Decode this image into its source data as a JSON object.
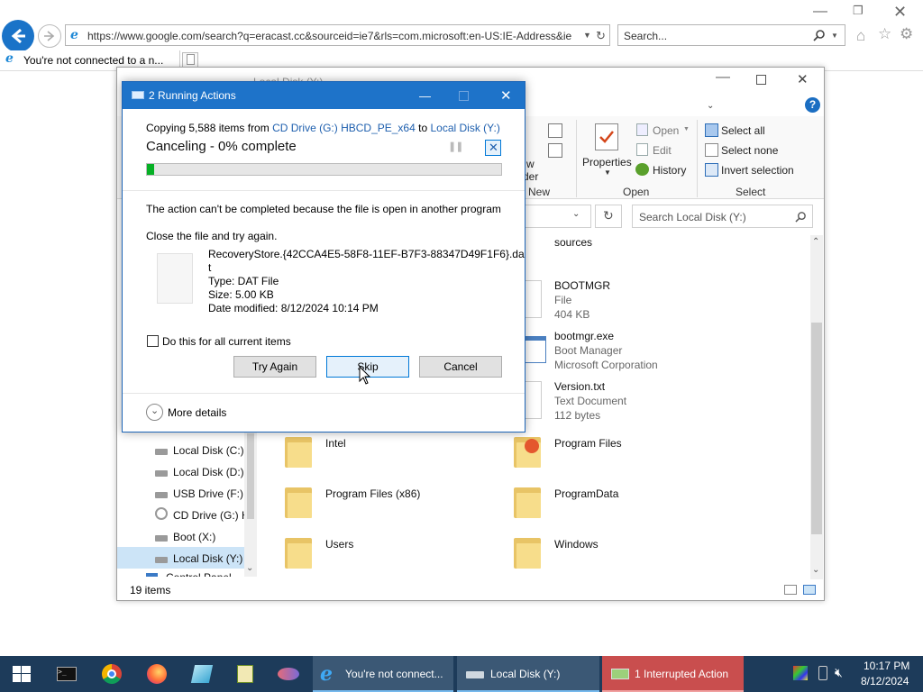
{
  "browser": {
    "address": "https://www.google.com/search?q=eracast.cc&sourceid=ie7&rls=com.microsoft:en-US:IE-Address&ie",
    "search_placeholder": "Search...",
    "tab_title": "You're not connected to a n..."
  },
  "explorer": {
    "title": "Local Disk (Y:)",
    "ribbon": {
      "new_partial": "w",
      "new_partial2": "der",
      "new_label": "New",
      "properties": "Properties",
      "open": "Open",
      "edit": "Edit",
      "history": "History",
      "open_group": "Open",
      "select_all": "Select all",
      "select_none": "Select none",
      "invert_selection": "Invert selection",
      "select_group": "Select"
    },
    "search_placeholder": "Search Local Disk (Y:)",
    "nav_items": [
      "Local Disk (C:)",
      "Local Disk (D:)",
      "USB Drive (F:)",
      "CD Drive (G:) H",
      "Boot (X:)",
      "Local Disk (Y:)",
      "Control Panel"
    ],
    "files": {
      "sources": "sources",
      "bootmgr": {
        "name": "BOOTMGR",
        "type": "File",
        "size": "404 KB"
      },
      "bootmgr_exe": {
        "name": "bootmgr.exe",
        "desc": "Boot Manager",
        "company": "Microsoft Corporation"
      },
      "version": {
        "name": "Version.txt",
        "type": "Text Document",
        "size": "112 bytes"
      },
      "intel": "Intel",
      "program_files": "Program Files",
      "program_files_x86": "Program Files (x86)",
      "program_data": "ProgramData",
      "users": "Users",
      "windows": "Windows"
    },
    "status": "19 items"
  },
  "dialog": {
    "title": "2 Running Actions",
    "copy_prefix": "Copying 5,588 items from",
    "copy_source": "CD Drive (G:) HBCD_PE_x64",
    "copy_to": "to",
    "copy_dest": "Local Disk (Y:)",
    "status": "Canceling - 0% complete",
    "progress": 0.02,
    "message": "The action can't be completed because the file is open in another program",
    "instruction": "Close the file and try again.",
    "file_name_line1": "RecoveryStore.{42CCA4E5-58F8-11EF-B7F3-88347D49F1F6}.da",
    "file_name_line2": "t",
    "file_type": "Type: DAT File",
    "file_size": "Size: 5.00 KB",
    "file_modified": "Date modified: 8/12/2024 10:14 PM",
    "checkbox_label": "Do this for all current items",
    "btn_try_again": "Try Again",
    "btn_skip": "Skip",
    "btn_cancel": "Cancel",
    "more_details": "More details"
  },
  "taskbar": {
    "ie_task": "You're not connect...",
    "explorer_task": "Local Disk (Y:)",
    "interrupted_task": "1 Interrupted Action",
    "time": "10:17 PM",
    "date": "8/12/2024",
    "interrupted_color": "#c94e4e"
  }
}
